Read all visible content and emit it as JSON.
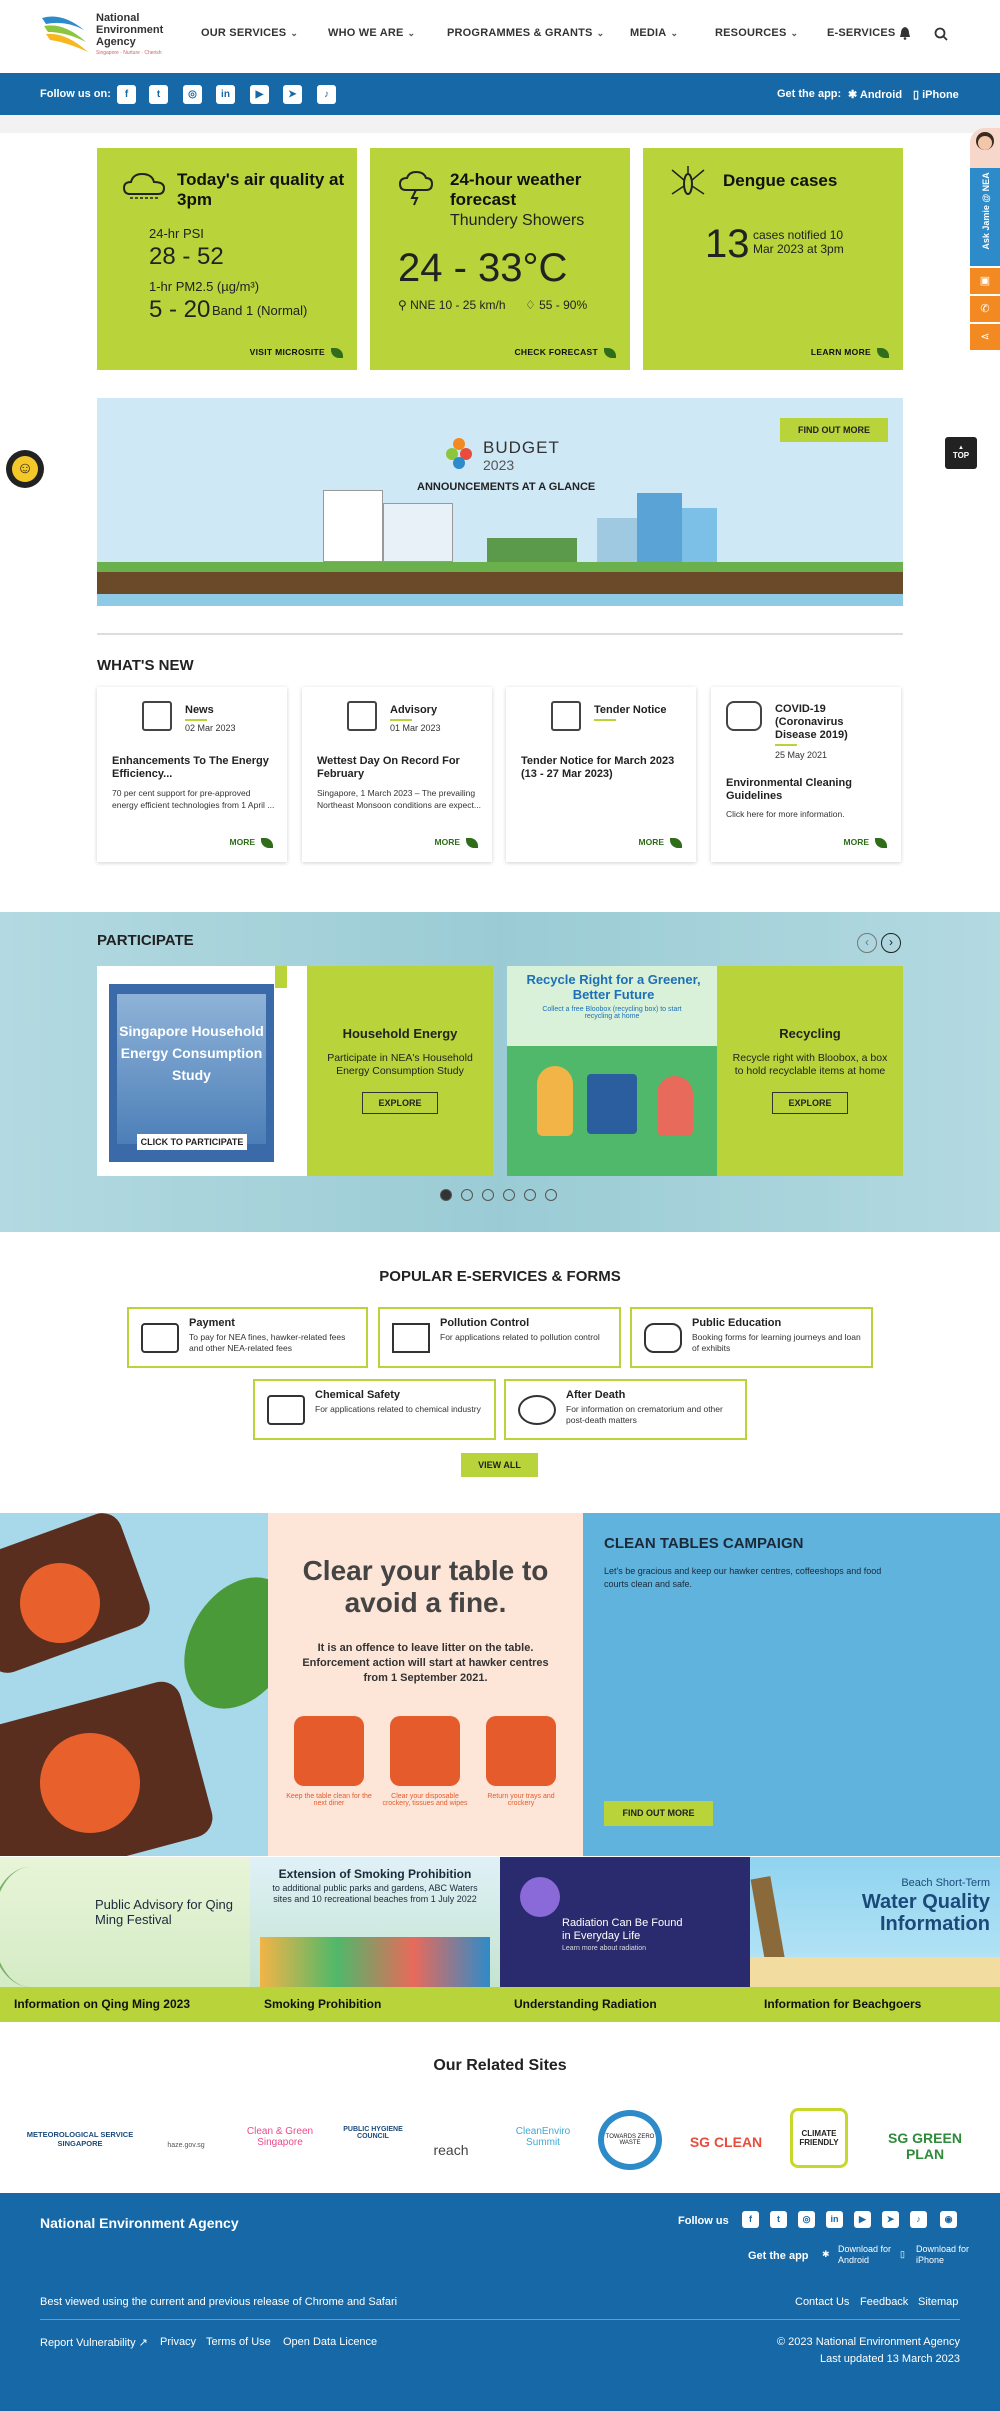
{
  "header": {
    "logo_line1": "National",
    "logo_line2": "Environment",
    "logo_line3": "Agency",
    "logo_tagline": "Singapore · Nurture · Cherish",
    "nav": [
      "OUR SERVICES",
      "WHO WE ARE",
      "PROGRAMMES & GRANTS",
      "MEDIA",
      "RESOURCES",
      "E-SERVICES"
    ]
  },
  "social_bar": {
    "follow_label": "Follow us on:",
    "icons": [
      "facebook-icon",
      "twitter-icon",
      "instagram-icon",
      "linkedin-icon",
      "youtube-icon",
      "telegram-icon",
      "tiktok-icon"
    ],
    "get_app_label": "Get the app:",
    "android_label": "Android",
    "iphone_label": "iPhone"
  },
  "side_widget": {
    "ask_label": "Ask Jamie @ NEA",
    "top_label": "TOP"
  },
  "tiles": {
    "air": {
      "title": "Today's air quality at 3pm",
      "psi_label": "24-hr PSI",
      "psi_value": "28 - 52",
      "pm_label": "1-hr PM2.5 (µg/m³)",
      "pm_value": "5 - 20",
      "pm_band": "Band 1 (Normal)",
      "link": "VISIT MICROSITE"
    },
    "weather": {
      "title": "24-hour weather forecast",
      "subtitle": "Thundery Showers",
      "temp": "24 - 33°C",
      "wind": "NNE 10 - 25 km/h",
      "humidity": "55 - 90%",
      "link": "CHECK FORECAST"
    },
    "dengue": {
      "title": "Dengue cases",
      "count": "13",
      "desc": "cases notified 10 Mar 2023 at 3pm",
      "link": "LEARN MORE"
    }
  },
  "banner": {
    "brand": "BUDGET",
    "year": "2023",
    "headline": "ANNOUNCEMENTS AT A GLANCE",
    "button": "FIND OUT MORE"
  },
  "whats_new": {
    "heading": "WHAT'S NEW",
    "cards": [
      {
        "category": "News",
        "date": "02 Mar 2023",
        "title": "Enhancements To The Energy Efficiency...",
        "desc": "70 per cent support for pre-approved energy efficient technologies from 1 April ...",
        "more": "MORE"
      },
      {
        "category": "Advisory",
        "date": "01 Mar 2023",
        "title": "Wettest Day On Record For February",
        "desc": "Singapore, 1 March 2023 – The prevailing Northeast Monsoon conditions are expect...",
        "more": "MORE"
      },
      {
        "category": "Tender Notice",
        "date": "",
        "title": "Tender Notice for March 2023 (13 - 27 Mar 2023)",
        "desc": "",
        "more": "MORE"
      },
      {
        "category": "COVID-19 (Coronavirus Disease 2019)",
        "date": "25 May 2021",
        "title": "Environmental Cleaning Guidelines",
        "desc": "Click here for more information.",
        "more": "MORE"
      }
    ]
  },
  "participate": {
    "heading": "PARTICIPATE",
    "items": [
      {
        "image_title": "Singapore Household Energy Consumption Study",
        "image_cta": "CLICK TO PARTICIPATE",
        "title": "Household Energy",
        "desc": "Participate in NEA's Household Energy Consumption Study",
        "button": "EXPLORE"
      },
      {
        "image_title": "Recycle Right for a Greener, Better Future",
        "image_cta": "Collect a free Bloobox (recycling box) to start recycling at home",
        "title": "Recycling",
        "desc": "Recycle right with Bloobox, a box to hold recyclable items at home",
        "button": "EXPLORE"
      }
    ],
    "dots": 6,
    "active_dot": 0
  },
  "eservices": {
    "heading": "POPULAR E-SERVICES & FORMS",
    "items": [
      {
        "title": "Payment",
        "desc": "To pay for NEA fines, hawker-related fees and other NEA-related fees"
      },
      {
        "title": "Pollution Control",
        "desc": "For applications related to pollution control"
      },
      {
        "title": "Public Education",
        "desc": "Booking forms for learning journeys and loan of exhibits"
      },
      {
        "title": "Chemical Safety",
        "desc": "For applications related to chemical industry"
      },
      {
        "title": "After Death",
        "desc": "For information on crematorium and other post-death matters"
      }
    ],
    "view_all": "VIEW ALL"
  },
  "clean_tables": {
    "poster_headline": "Clear your table to avoid a fine.",
    "poster_text": "It is an offence to leave litter on the table. Enforcement action will start at hawker centres from 1 September 2021.",
    "poster_steps": [
      "Keep the table clean for the next diner",
      "Clear your disposable crockery, tissues and wipes",
      "Return your trays and crockery"
    ],
    "heading": "CLEAN TABLES CAMPAIGN",
    "desc": "Let's be gracious and keep our hawker centres, coffeeshops and food courts clean and safe.",
    "button": "FIND OUT MORE"
  },
  "promos": [
    {
      "image_text": "Public Advisory for Qing Ming Festival",
      "label": "Information on Qing Ming 2023"
    },
    {
      "image_text": "Extension of Smoking Prohibition",
      "image_sub": "to additional public parks and gardens, ABC Waters sites and 10 recreational beaches from 1 July 2022",
      "label": "Smoking Prohibition"
    },
    {
      "image_text": "Radiation Can Be Found in Everyday Life",
      "image_sub": "Learn more about radiation",
      "label": "Understanding Radiation"
    },
    {
      "image_text": "Beach Short-Term",
      "image_big": "Water Quality Information",
      "label": "Information for Beachgoers"
    }
  ],
  "related_sites": {
    "heading": "Our Related Sites",
    "sites": [
      "METEOROLOGICAL SERVICE SINGAPORE",
      "haze.gov.sg",
      "Clean & Green Singapore",
      "PUBLIC HYGIENE COUNCIL",
      "reach",
      "CleanEnviro Summit",
      "TOWARDS ZERO WASTE",
      "SG CLEAN",
      "CLIMATE FRIENDLY",
      "SG GREEN PLAN"
    ]
  },
  "footer": {
    "org_name": "National Environment Agency",
    "follow_us": "Follow us",
    "get_app": "Get the app",
    "download_android": "Download for Android",
    "download_iphone": "Download for iPhone",
    "browser_note": "Best viewed using the current and previous release of Chrome and Safari",
    "links_right": [
      "Contact Us",
      "Feedback",
      "Sitemap"
    ],
    "links_left": [
      "Report Vulnerability",
      "Privacy",
      "Terms of Use",
      "Open Data Licence"
    ],
    "copyright": "© 2023 National Environment Agency",
    "updated": "Last updated 13 March 2023"
  },
  "colors": {
    "brand_blue": "#1668a6",
    "lime": "#b8d43a",
    "dark_green": "#2f6d1a",
    "campaign_blue": "#5fb3dc"
  }
}
